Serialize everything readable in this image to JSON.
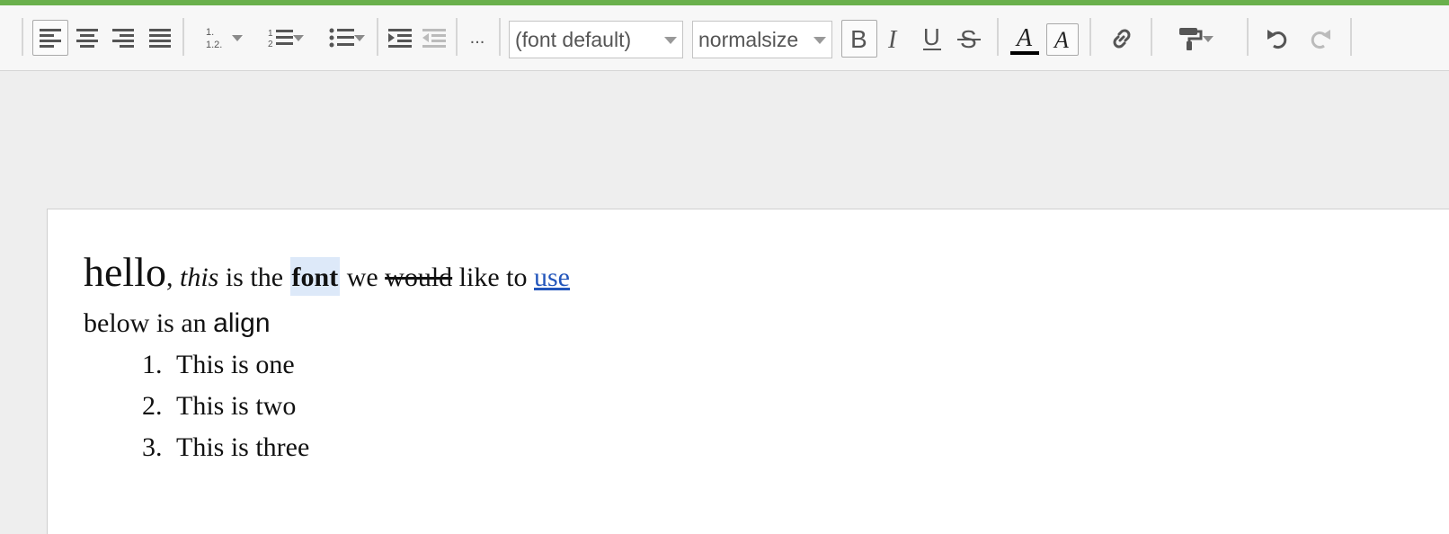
{
  "toolbar": {
    "font_family_value": "(font default)",
    "font_size_value": "normalsize",
    "more_label": "..."
  },
  "editor": {
    "line1": {
      "w1": "hello",
      "w2": ",",
      "w3": "this",
      "w4": "is the",
      "w5": "font",
      "w6": "we",
      "w7": "would",
      "w8": "like to",
      "w9": "use"
    },
    "line2": {
      "w1": "below is an",
      "w2": "align"
    },
    "list": [
      "This is one",
      "This is two",
      "This is three"
    ]
  },
  "colors": {
    "accent": "#6ab04c",
    "selection": "#dde9f9",
    "link": "#2255bb"
  }
}
